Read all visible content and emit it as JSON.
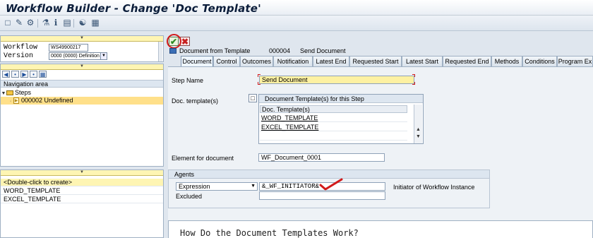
{
  "window": {
    "title": "Workflow Builder - Change 'Doc Template'"
  },
  "toolbar": {
    "icons": [
      "new-icon",
      "other-object-icon",
      "display-change-icon",
      "generate-icon",
      "print-icon",
      "settings-icon",
      "layout-icon"
    ]
  },
  "left": {
    "workflow_label": "Workflow",
    "workflow_value": "WS49900217",
    "version_label": "Version",
    "version_value": "0000 (0000) Definition",
    "nav_header": "Navigation area",
    "tree": [
      {
        "label": "Steps"
      },
      {
        "label": "000002 Undefined"
      }
    ],
    "list_rows": [
      "<Double-click to create>",
      "WORD_TEMPLATE",
      "EXCEL_TEMPLATE"
    ]
  },
  "step_header": {
    "type": "Document from Template",
    "number": "000004",
    "name": "Send Document"
  },
  "tabs": [
    "Document",
    "Control",
    "Outcomes",
    "Notification",
    "Latest End",
    "Requested Start",
    "Latest Start",
    "Requested End",
    "Methods",
    "Conditions",
    "Program Ex"
  ],
  "form": {
    "step_name_label": "Step Name",
    "step_name_value": "Send Document",
    "doc_templates_label": "Doc. template(s)",
    "templates_title": "Document Template(s) for this Step",
    "templates_col": "Doc. Template(s)",
    "templates": [
      "WORD_TEMPLATE",
      "EXCEL_TEMPLATE"
    ],
    "element_label": "Element for document",
    "element_value": "WF_Document_0001"
  },
  "agents": {
    "title": "Agents",
    "expression_label": "Expression",
    "expression_value": "&_WF_INITIATOR&",
    "expression_desc": "Initiator of Workflow Instance",
    "excluded_label": "Excluded",
    "excluded_value": ""
  },
  "bottom": {
    "text": "How Do the Document Templates Work?"
  },
  "colors": {
    "accent_red": "#d21a1a",
    "highlight_yellow": "#fdf1a2",
    "selected_row": "#ffe08a"
  }
}
